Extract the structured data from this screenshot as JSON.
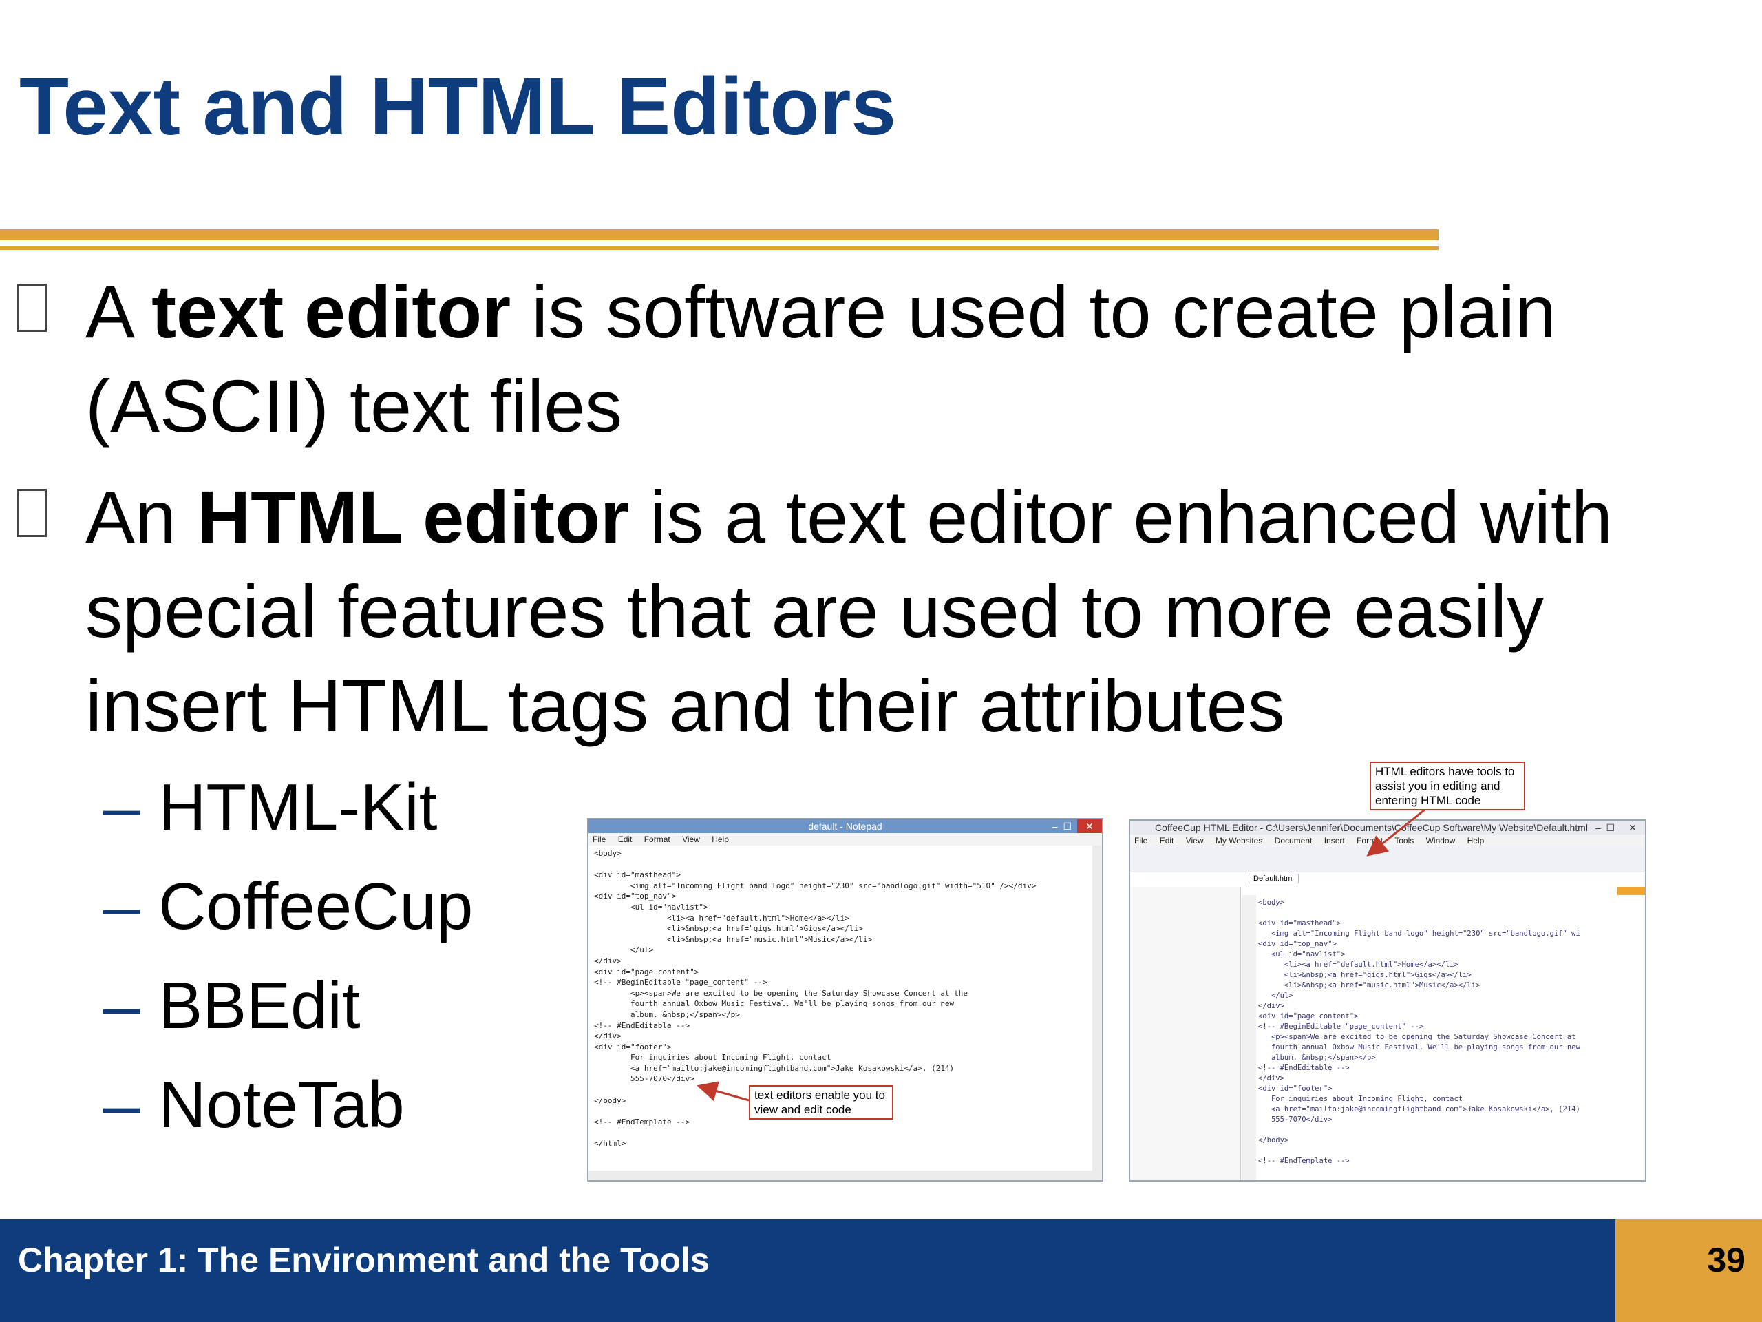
{
  "slide": {
    "title": "Text and HTML Editors",
    "bullets": [
      {
        "prefix": "A ",
        "bold": "text editor",
        "rest": " is software used to create plain (ASCII) text files"
      },
      {
        "prefix": "An ",
        "bold": "HTML editor",
        "rest": " is a text editor enhanced with special features that are used to more easily insert HTML tags and their attributes"
      }
    ],
    "sub_items": [
      "HTML-Kit",
      "CoffeeCup",
      "BBEdit",
      "NoteTab"
    ],
    "dash": "–"
  },
  "notepad": {
    "title": "default - Notepad",
    "menu": [
      "File",
      "Edit",
      "Format",
      "View",
      "Help"
    ],
    "code": "<body>\n\n<div id=\"masthead\">\n        <img alt=\"Incoming Flight band logo\" height=\"230\" src=\"bandlogo.gif\" width=\"510\" /></div>\n<div id=\"top_nav\">\n        <ul id=\"navlist\">\n                <li><a href=\"default.html\">Home</a></li>\n                <li>&nbsp;<a href=\"gigs.html\">Gigs</a></li>\n                <li>&nbsp;<a href=\"music.html\">Music</a></li>\n        </ul>\n</div>\n<div id=\"page_content\">\n<!-- #BeginEditable \"page_content\" -->\n        <p><span>We are excited to be opening the Saturday Showcase Concert at the\n        fourth annual Oxbow Music Festival. We'll be playing songs from our new\n        album. &nbsp;</span></p>\n<!-- #EndEditable -->\n</div>\n<div id=\"footer\">\n        For inquiries about Incoming Flight, contact\n        <a href=\"mailto:jake@incomingflightband.com\">Jake Kosakowski</a>, (214)\n        555-7070</div>\n\n</body>\n\n<!-- #EndTemplate -->\n\n</html>",
    "callout": "text editors enable you to view and edit code"
  },
  "coffeecup": {
    "title": "CoffeeCup HTML Editor - C:\\Users\\Jennifer\\Documents\\CoffeeCup Software\\My Website\\Default.html",
    "menu": [
      "File",
      "Edit",
      "View",
      "My Websites",
      "Document",
      "Insert",
      "Format",
      "Tools",
      "Window",
      "Help"
    ],
    "tab": "Default.html",
    "code": "<body>\n\n<div id=\"masthead\">\n   <img alt=\"Incoming Flight band logo\" height=\"230\" src=\"bandlogo.gif\" wi\n<div id=\"top_nav\">\n   <ul id=\"navlist\">\n      <li><a href=\"default.html\">Home</a></li>\n      <li>&nbsp;<a href=\"gigs.html\">Gigs</a></li>\n      <li>&nbsp;<a href=\"music.html\">Music</a></li>\n   </ul>\n</div>\n<div id=\"page_content\">\n<!-- #BeginEditable \"page_content\" -->\n   <p><span>We are excited to be opening the Saturday Showcase Concert at\n   fourth annual Oxbow Music Festival. We'll be playing songs from our new\n   album. &nbsp;</span></p>\n<!-- #EndEditable -->\n</div>\n<div id=\"footer\">\n   For inquiries about Incoming Flight, contact\n   <a href=\"mailto:jake@incomingflightband.com\">Jake Kosakowski</a>, (214)\n   555-7070</div>\n\n</body>\n\n<!-- #EndTemplate -->",
    "callout": "HTML editors have tools to assist you in editing and entering HTML code"
  },
  "footer": {
    "chapter": "Chapter 1: The Environment and the Tools",
    "page": "39"
  },
  "colors": {
    "title_blue": "#0f3c7d",
    "accent_gold": "#e1a23a",
    "callout_red": "#c0392b"
  }
}
